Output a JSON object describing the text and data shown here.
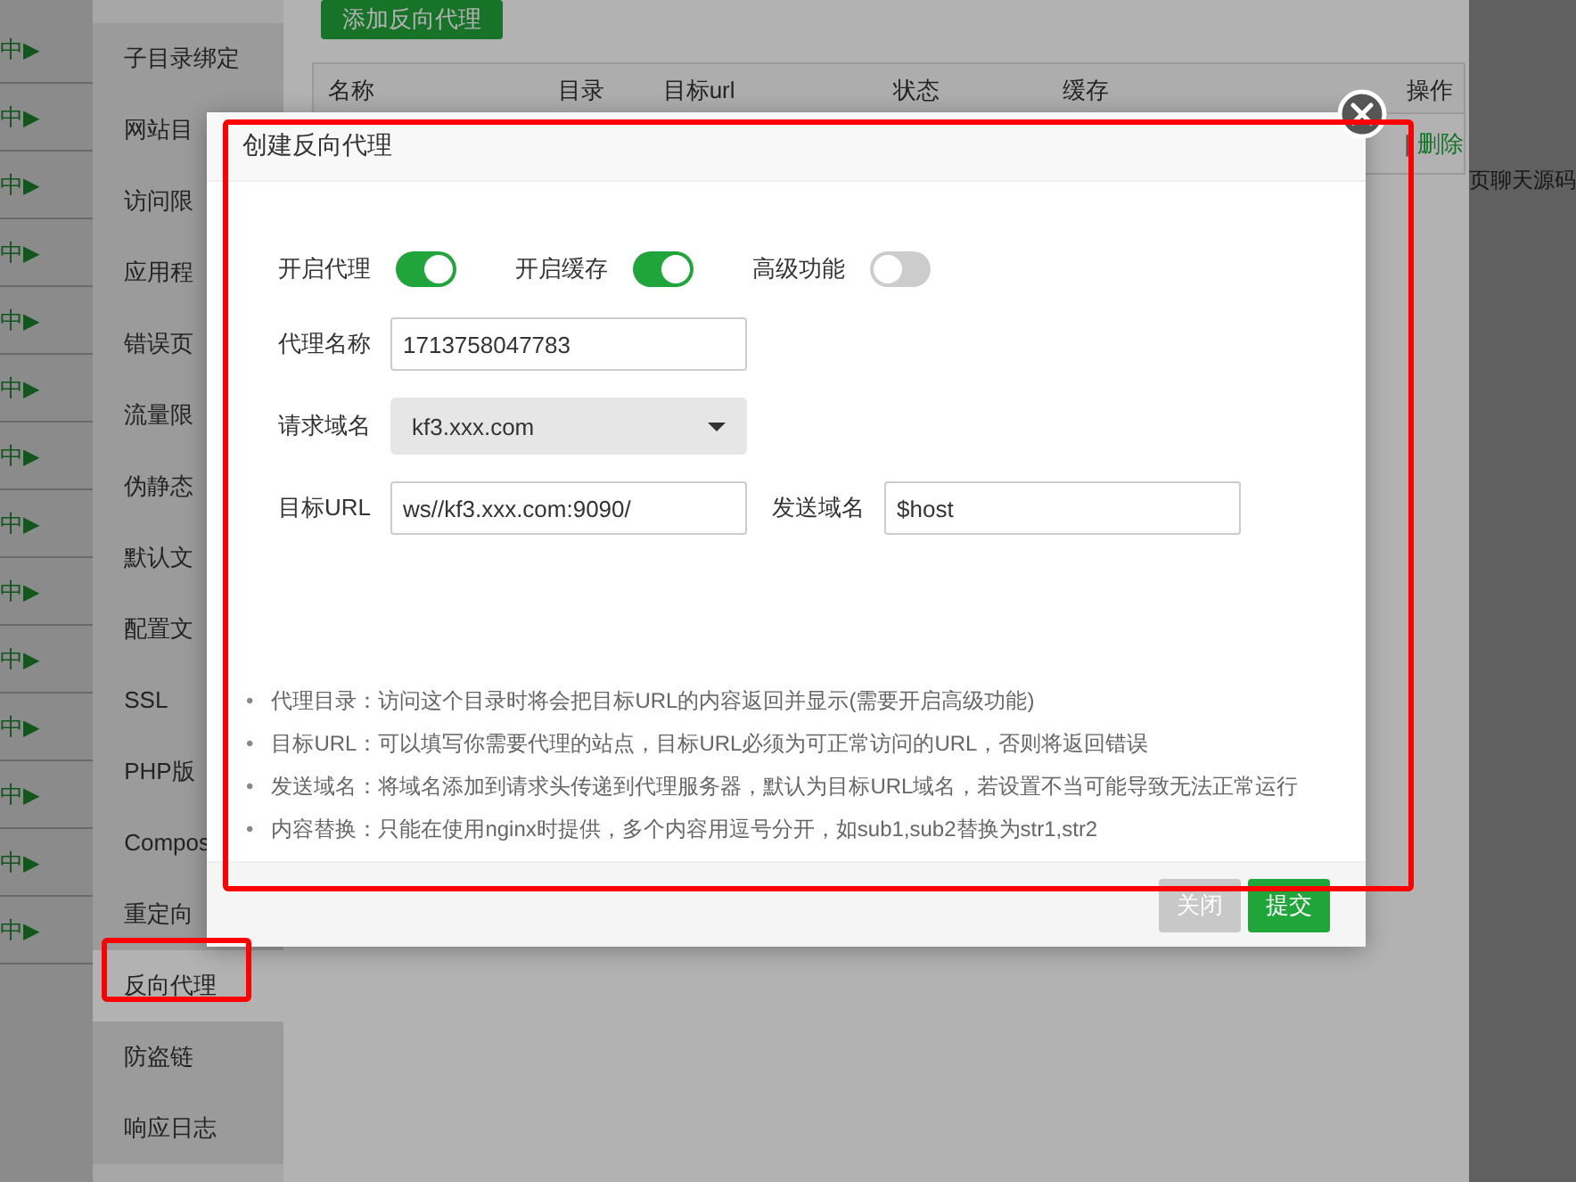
{
  "left_column": [
    {
      "label": "中",
      "arrow": "▶"
    },
    {
      "label": "中",
      "arrow": "▶"
    },
    {
      "label": "中",
      "arrow": "▶"
    },
    {
      "label": "中",
      "arrow": "▶"
    },
    {
      "label": "中",
      "arrow": "▶"
    },
    {
      "label": "中",
      "arrow": "▶"
    },
    {
      "label": "中",
      "arrow": "▶"
    },
    {
      "label": "中",
      "arrow": "▶"
    },
    {
      "label": "中",
      "arrow": "▶"
    },
    {
      "label": "中",
      "arrow": "▶"
    },
    {
      "label": "中",
      "arrow": "▶"
    },
    {
      "label": "中",
      "arrow": "▶"
    },
    {
      "label": "中",
      "arrow": "▶"
    },
    {
      "label": "中",
      "arrow": "▶"
    }
  ],
  "sidebar": {
    "items": [
      {
        "label": "子目录绑定",
        "selected": false
      },
      {
        "label": "网站目",
        "selected": false
      },
      {
        "label": "访问限",
        "selected": false
      },
      {
        "label": "应用程",
        "selected": false
      },
      {
        "label": "错误页",
        "selected": false
      },
      {
        "label": "流量限",
        "selected": false
      },
      {
        "label": "伪静态",
        "selected": false
      },
      {
        "label": "默认文",
        "selected": false
      },
      {
        "label": "配置文",
        "selected": false
      },
      {
        "label": "SSL",
        "selected": false
      },
      {
        "label": "PHP版",
        "selected": false
      },
      {
        "label": "Compos",
        "selected": false
      },
      {
        "label": "重定向",
        "selected": false
      },
      {
        "label": "反向代理",
        "selected": true
      },
      {
        "label": "防盗链",
        "selected": false
      },
      {
        "label": "响应日志",
        "selected": false
      }
    ]
  },
  "add_button": "添加反向代理",
  "table": {
    "columns": [
      "名称",
      "目录",
      "目标url",
      "状态",
      "缓存",
      "操作"
    ],
    "rows": [
      {
        "divider": "|",
        "action": "删除"
      }
    ]
  },
  "right_text": "页聊天源码",
  "dialog": {
    "title": "创建反向代理",
    "toggles": [
      {
        "label": "开启代理",
        "on": true
      },
      {
        "label": "开启缓存",
        "on": true
      },
      {
        "label": "高级功能",
        "on": false
      }
    ],
    "rows": [
      {
        "fields": [
          {
            "kind": "input",
            "label": "代理名称",
            "value": "1713758047783"
          }
        ]
      },
      {
        "fields": [
          {
            "kind": "select",
            "label": "请求域名",
            "value": "kf3.xxx.com"
          }
        ]
      },
      {
        "fields": [
          {
            "kind": "input",
            "label": "目标URL",
            "value": "ws//kf3.xxx.com:9090/"
          },
          {
            "kind": "input",
            "label": "发送域名",
            "value": "$host"
          }
        ]
      }
    ],
    "notes": [
      {
        "bullet": "•",
        "text": "代理目录：访问这个目录时将会把目标URL的内容返回并显示(需要开启高级功能)"
      },
      {
        "bullet": "•",
        "text": "目标URL：可以填写你需要代理的站点，目标URL必须为可正常访问的URL，否则将返回错误"
      },
      {
        "bullet": "•",
        "text": "发送域名：将域名添加到请求头传递到代理服务器，默认为目标URL域名，若设置不当可能导致无法正常运行"
      },
      {
        "bullet": "•",
        "text": "内容替换：只能在使用nginx时提供，多个内容用逗号分开，如sub1,sub2替换为str1,str2"
      }
    ],
    "buttons": [
      {
        "label": "关闭",
        "disabled": true
      },
      {
        "label": "提交",
        "disabled": false
      }
    ]
  }
}
